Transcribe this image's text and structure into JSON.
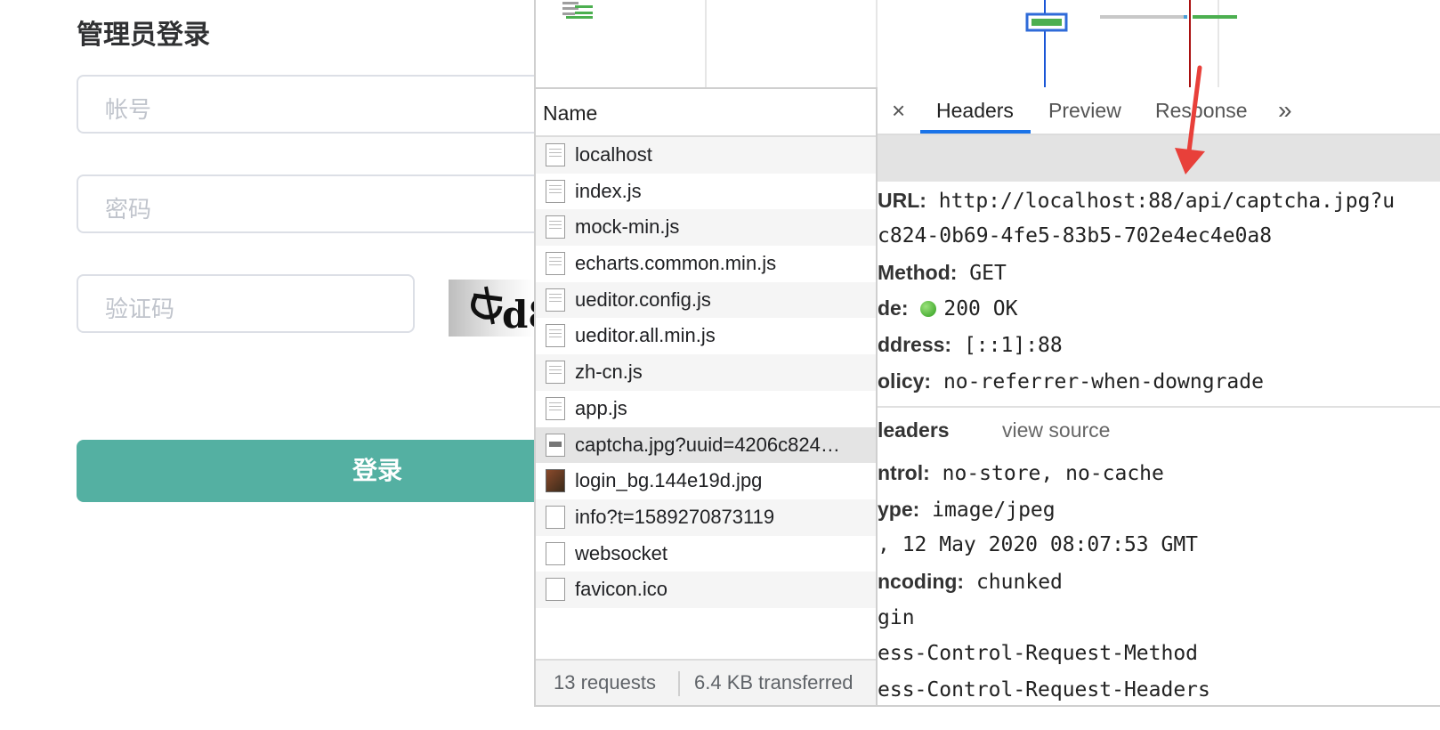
{
  "login": {
    "title": "管理员登录",
    "username_placeholder": "帐号",
    "password_placeholder": "密码",
    "captcha_placeholder": "验证码",
    "captcha_text": "d8",
    "submit_label": "登录"
  },
  "devtools": {
    "name_header": "Name",
    "requests": [
      {
        "name": "localhost",
        "icon": "document-icon"
      },
      {
        "name": "index.js",
        "icon": "document-icon"
      },
      {
        "name": "mock-min.js",
        "icon": "document-icon"
      },
      {
        "name": "echarts.common.min.js",
        "icon": "document-icon"
      },
      {
        "name": "ueditor.config.js",
        "icon": "document-icon"
      },
      {
        "name": "ueditor.all.min.js",
        "icon": "document-icon"
      },
      {
        "name": "zh-cn.js",
        "icon": "document-icon"
      },
      {
        "name": "app.js",
        "icon": "document-icon"
      },
      {
        "name": "captcha.jpg?uuid=4206c824…",
        "icon": "image-icon"
      },
      {
        "name": "login_bg.144e19d.jpg",
        "icon": "photo-icon"
      },
      {
        "name": "info?t=1589270873119",
        "icon": "blank-file-icon"
      },
      {
        "name": "websocket",
        "icon": "blank-file-icon"
      },
      {
        "name": "favicon.ico",
        "icon": "blank-file-icon"
      }
    ],
    "status": {
      "requests": "13 requests",
      "transferred": "6.4 KB transferred"
    },
    "tabs": {
      "close": "×",
      "headers": "Headers",
      "preview": "Preview",
      "response": "Response",
      "more": "»"
    },
    "general": {
      "url_key": "URL:",
      "url_value": "http://localhost:88/api/captcha.jpg?u",
      "url_cont": "c824-0b69-4fe5-83b5-702e4ec4e0a8",
      "method_key": "Method:",
      "method_value": "GET",
      "code_key": "de:",
      "code_value": "200 OK",
      "address_key": "ddress:",
      "address_value": "[::1]:88",
      "policy_key": "olicy:",
      "policy_value": "no-referrer-when-downgrade"
    },
    "response_headers": {
      "title": "leaders",
      "view_source": "view source",
      "cache_key": "ntrol:",
      "cache_value": "no-store, no-cache",
      "type_key": "ype:",
      "type_value": "image/jpeg",
      "date_value": ", 12 May 2020 08:07:53 GMT",
      "encoding_key": "ncoding:",
      "encoding_value": "chunked",
      "origin_line": "gin",
      "method_line": "ess-Control-Request-Method",
      "headers_line": "ess-Control-Request-Headers"
    },
    "colors": {
      "accent_blue": "#1a73e8",
      "login_button": "#54b0a2",
      "annotation_arrow": "#e8403a"
    }
  }
}
